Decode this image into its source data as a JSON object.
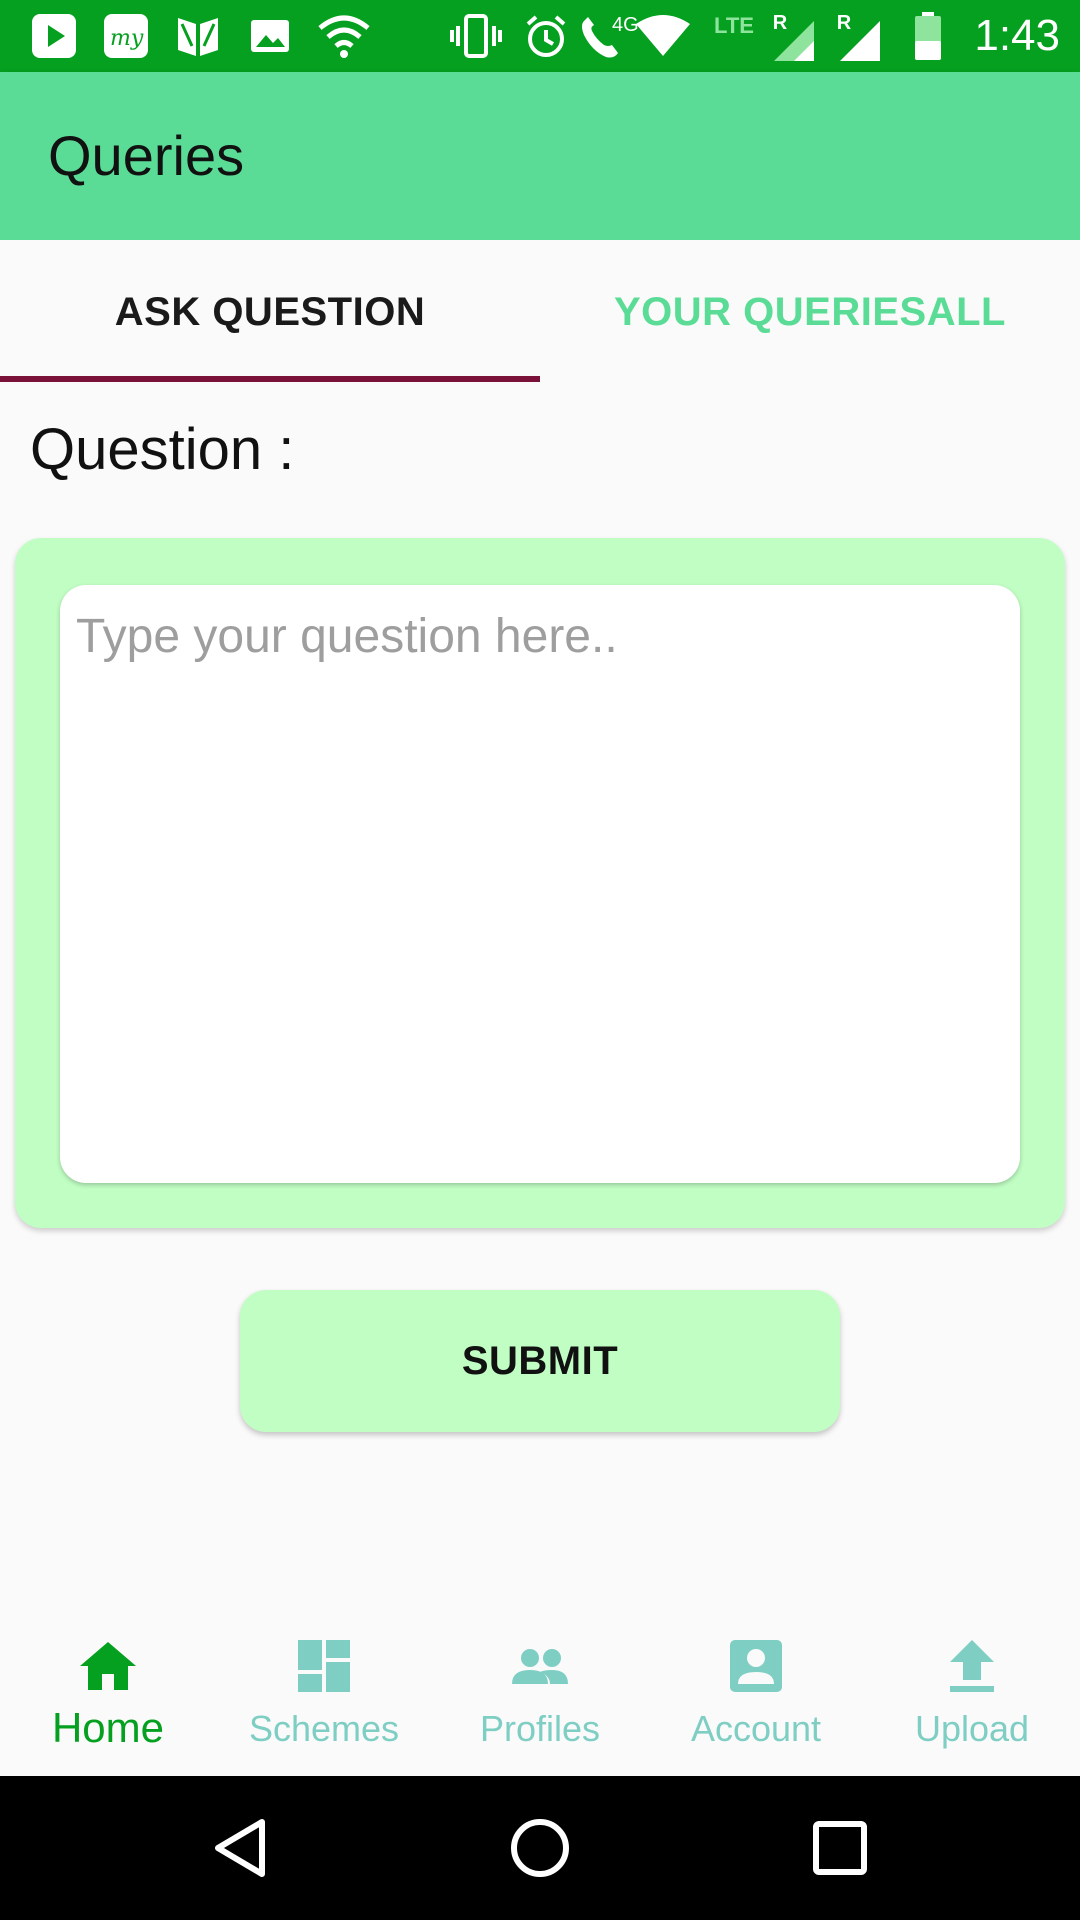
{
  "status_bar": {
    "time": "1:43",
    "network_4g": "4G",
    "network_lte": "LTE",
    "roaming_1": "R",
    "roaming_2": "R",
    "icons": [
      "play-store-icon",
      "my-app-icon",
      "book-icon",
      "image-icon",
      "wifi-icon",
      "vibrate-icon",
      "alarm-icon",
      "wifi-call-icon",
      "wifi-signal-icon",
      "cell-signal-icon",
      "cell-signal-icon",
      "battery-icon"
    ]
  },
  "app_bar": {
    "title": "Queries"
  },
  "tabs": [
    {
      "label": "ASK QUESTION",
      "active": true
    },
    {
      "label": "YOUR QUERIESALL",
      "active": false
    }
  ],
  "form": {
    "question_label": "Question :",
    "question_placeholder": "Type your question here..",
    "question_value": "",
    "submit_label": "SUBMIT"
  },
  "bottom_nav": {
    "items": [
      {
        "label": "Home",
        "icon": "home-icon",
        "active": true
      },
      {
        "label": "Schemes",
        "icon": "dashboard-icon",
        "active": false
      },
      {
        "label": "Profiles",
        "icon": "people-icon",
        "active": false
      },
      {
        "label": "Account",
        "icon": "account-box-icon",
        "active": false
      },
      {
        "label": "Upload",
        "icon": "upload-icon",
        "active": false
      }
    ]
  },
  "system_nav": {
    "icons": [
      "back-icon",
      "home-circle-icon",
      "recents-icon"
    ]
  },
  "colors": {
    "status_bar": "#05a01f",
    "app_bar": "#5adc96",
    "card": "#c1fec4",
    "tab_indicator": "#7a1138",
    "nav_active": "#05a01f",
    "nav_inactive": "#7ecec4"
  }
}
